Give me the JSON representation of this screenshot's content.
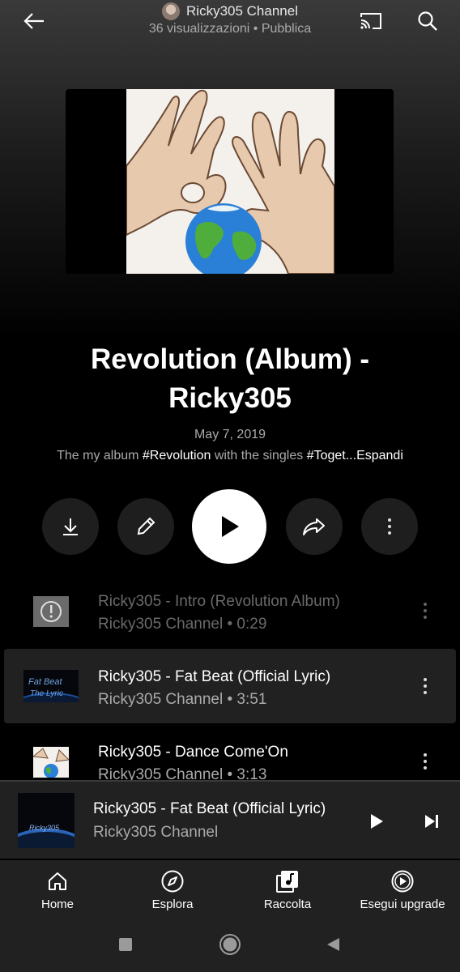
{
  "header": {
    "channel_name": "Ricky305 Channel",
    "meta": "36 visualizzazioni • Pubblica"
  },
  "album": {
    "title_line1": "Revolution (Album) -",
    "title_line2": "Ricky305",
    "date": "May 7, 2019",
    "desc_prefix": "The my album ",
    "desc_tag1": "#Revolution",
    "desc_middle": " with the singles ",
    "desc_tag2": "#Toget...Espandi"
  },
  "tracks": [
    {
      "title": "Ricky305 - Intro (Revolution Album)",
      "subtitle": "Ricky305 Channel • 0:29"
    },
    {
      "title": "Ricky305 - Fat Beat (Official Lyric)",
      "subtitle": "Ricky305 Channel • 3:51"
    },
    {
      "title": "Ricky305 - Dance Come'On",
      "subtitle": "Ricky305 Channel • 3:13"
    }
  ],
  "mini_player": {
    "title": "Ricky305 - Fat Beat (Official Lyric)",
    "subtitle": "Ricky305 Channel",
    "thumb_text": "Ricky305"
  },
  "thumb_text_fatbeat": "Fat Beat The Lyric",
  "nav": {
    "home": "Home",
    "explore": "Esplora",
    "library": "Raccolta",
    "upgrade": "Esegui upgrade"
  },
  "icons": [
    "back-arrow-icon",
    "cast-icon",
    "search-icon",
    "download-icon",
    "edit-pencil-icon",
    "play-icon",
    "share-icon",
    "more-vert-icon",
    "next-icon",
    "home-icon",
    "compass-icon",
    "library-icon",
    "upgrade-play-icon"
  ],
  "colors": {
    "background": "#000000",
    "surface": "#212121",
    "secondary_text": "#aaaaaa"
  }
}
